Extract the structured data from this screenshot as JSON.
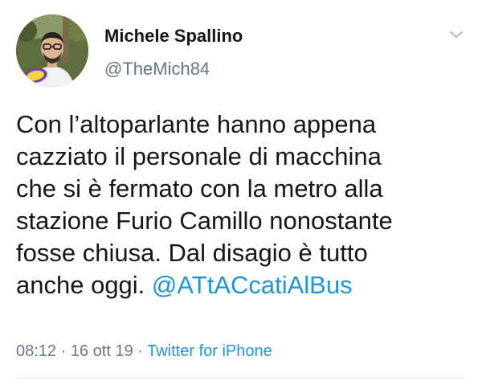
{
  "author": {
    "name": "Michele Spallino",
    "handle": "@TheMich84"
  },
  "tweet": {
    "text": "Con l’altoparlante hanno appena\ncazziato il personale di macchina\nche si è fermato con la metro alla\nstazione Furio Camillo nonostante\nfosse chiusa. Dal disagio è tutto\nanche oggi. ",
    "mention": "@ATtACcatiAlBus"
  },
  "meta": {
    "time": "08:12",
    "separator1": " · ",
    "date": "16 ott 19",
    "separator2": " · ",
    "source": "Twitter for iPhone"
  },
  "colors": {
    "link": "#1b95e0",
    "secondary_text": "#657786",
    "primary_text": "#14171a",
    "divider": "#e6ecf0"
  },
  "icons": {
    "menu": "chevron-down-icon",
    "avatar": "avatar"
  }
}
